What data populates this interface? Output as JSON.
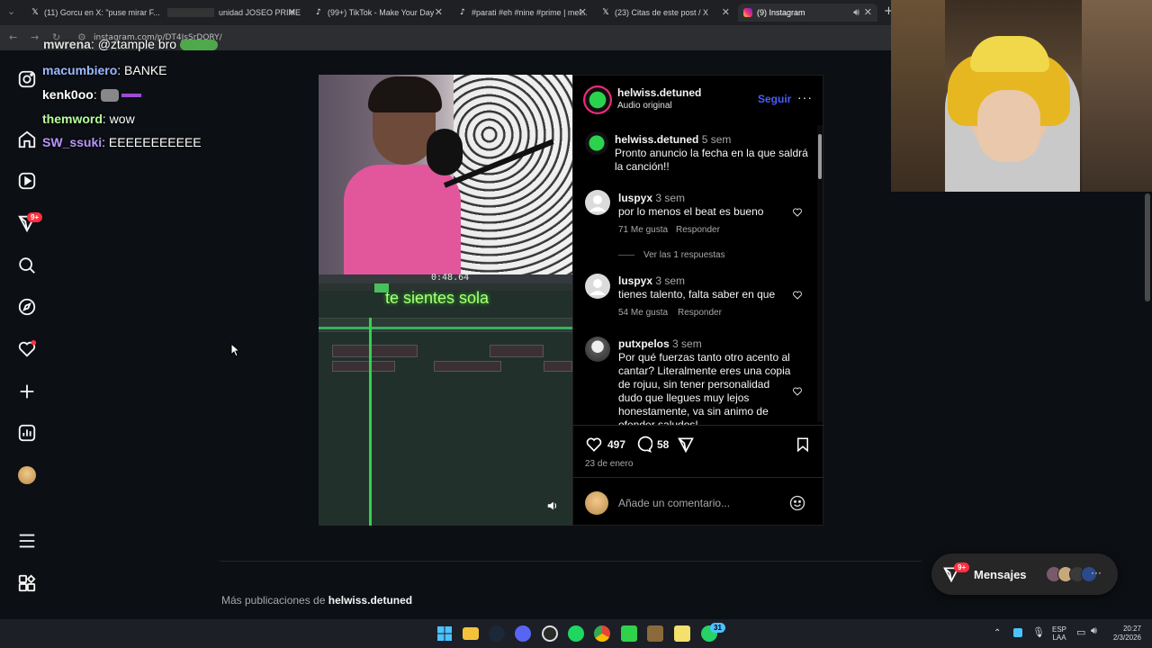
{
  "browser": {
    "tabs": [
      {
        "label": "(11) Gorcu en X: \"puse mirar F...",
        "icon": "x-icon",
        "active": false
      },
      {
        "label": "unidad JOSEO PRIME",
        "icon": "game-icon",
        "active": false
      },
      {
        "label": "(99+) TikTok - Make Your Day",
        "icon": "tiktok-icon",
        "active": false
      },
      {
        "label": "#parati #eh #nine #prime | mel...",
        "icon": "tiktok-icon",
        "active": false
      },
      {
        "label": "(23) Citas de este post / X",
        "icon": "x-icon",
        "active": false
      },
      {
        "label": "(9) Instagram",
        "icon": "instagram-icon",
        "active": true
      }
    ],
    "url": "instagram.com/p/DT4JsSrDORY/"
  },
  "chat": [
    {
      "user": "mwrena",
      "message": "@ztample bro",
      "color": "#e0e0e0"
    },
    {
      "user": "macumbiero",
      "message": "BANKE",
      "color": "#9fb9ff"
    },
    {
      "user": "kenk0oo",
      "message": "",
      "color": "#ffffff"
    },
    {
      "user": "themword",
      "message": "wow",
      "color": "#b6ff9a"
    },
    {
      "user": "SW_ssuki",
      "message": "EEEEEEEEEEE",
      "color": "#b995ff"
    }
  ],
  "sidebar": {
    "notifications_badge": "9+"
  },
  "post": {
    "author": "helwiss.detuned",
    "subtitle": "Audio original",
    "follow_label": "Seguir",
    "video_overlay_text": "te sientes sola",
    "daw_time": "0:48.64",
    "caption": {
      "user": "helwiss.detuned",
      "time": "5 sem",
      "text": "Pronto anuncio la fecha en la que saldrá la canción!!"
    },
    "comments": [
      {
        "user": "luspyx",
        "time": "3 sem",
        "text": "por lo menos el beat es bueno",
        "likes": "71 Me gusta",
        "reply": "Responder",
        "replies": "Ver las 1 respuestas"
      },
      {
        "user": "luspyx",
        "time": "3 sem",
        "text": "tienes talento, falta saber en que",
        "likes": "54 Me gusta",
        "reply": "Responder"
      },
      {
        "user": "putxpelos",
        "time": "3 sem",
        "text": "Por qué fuerzas tanto otro acento al cantar? Literalmente eres una copia de rojuu, sin tener personalidad dudo que llegues muy lejos honestamente, va sin animo de ofender saludos!"
      }
    ],
    "like_count": "497",
    "comment_count": "58",
    "date": "23 de enero",
    "comment_placeholder": "Añade un comentario..."
  },
  "more_posts": {
    "prefix": "Más publicaciones de",
    "user": "helwiss.detuned"
  },
  "messages": {
    "label": "Mensajes",
    "badge": "9+"
  },
  "taskbar": {
    "lang_top": "ESP",
    "lang_bottom": "LAA",
    "time": "20:27",
    "date": "2/3/2026",
    "whatsapp_badge": "31"
  },
  "colors": {
    "background": "#0c0f14",
    "accent_blue": "#4a5df9",
    "badge_red": "#ff3040"
  }
}
